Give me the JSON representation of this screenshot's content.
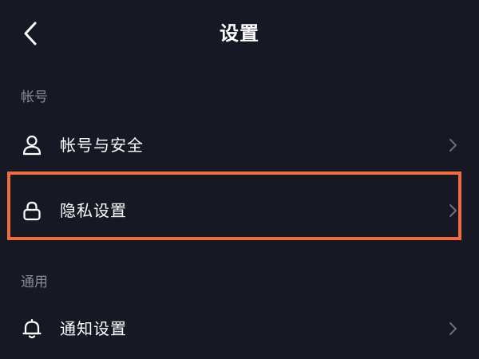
{
  "header": {
    "title": "设置",
    "back_icon": "chevron-left-icon"
  },
  "sections": [
    {
      "title": "帐号",
      "items": [
        {
          "label": "帐号与安全",
          "icon": "user-icon"
        },
        {
          "label": "隐私设置",
          "icon": "lock-icon",
          "highlighted": true
        }
      ]
    },
    {
      "title": "通用",
      "items": [
        {
          "label": "通知设置",
          "icon": "bell-icon"
        }
      ]
    }
  ],
  "colors": {
    "background": "#161823",
    "text_primary": "#ffffff",
    "text_secondary": "#8a8b93",
    "chevron": "#6d6e76",
    "highlight": "#f26b3a"
  }
}
